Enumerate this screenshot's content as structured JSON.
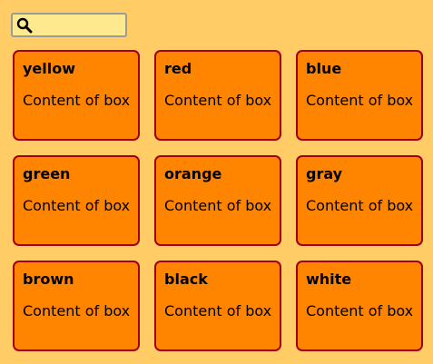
{
  "search": {
    "value": "",
    "placeholder": "",
    "icon": "search-icon"
  },
  "boxes": [
    {
      "title": "yellow",
      "content": "Content of box"
    },
    {
      "title": "red",
      "content": "Content of box"
    },
    {
      "title": "blue",
      "content": "Content of box"
    },
    {
      "title": "green",
      "content": "Content of box"
    },
    {
      "title": "orange",
      "content": "Content of box"
    },
    {
      "title": "gray",
      "content": "Content of box"
    },
    {
      "title": "brown",
      "content": "Content of box"
    },
    {
      "title": "black",
      "content": "Content of box"
    },
    {
      "title": "white",
      "content": "Content of box"
    }
  ],
  "colors": {
    "page_background": "#ffcc66",
    "box_fill": "#ff8400",
    "box_border": "#a0000f",
    "search_background": "#ffe98f",
    "search_border": "#9a9a9a"
  }
}
